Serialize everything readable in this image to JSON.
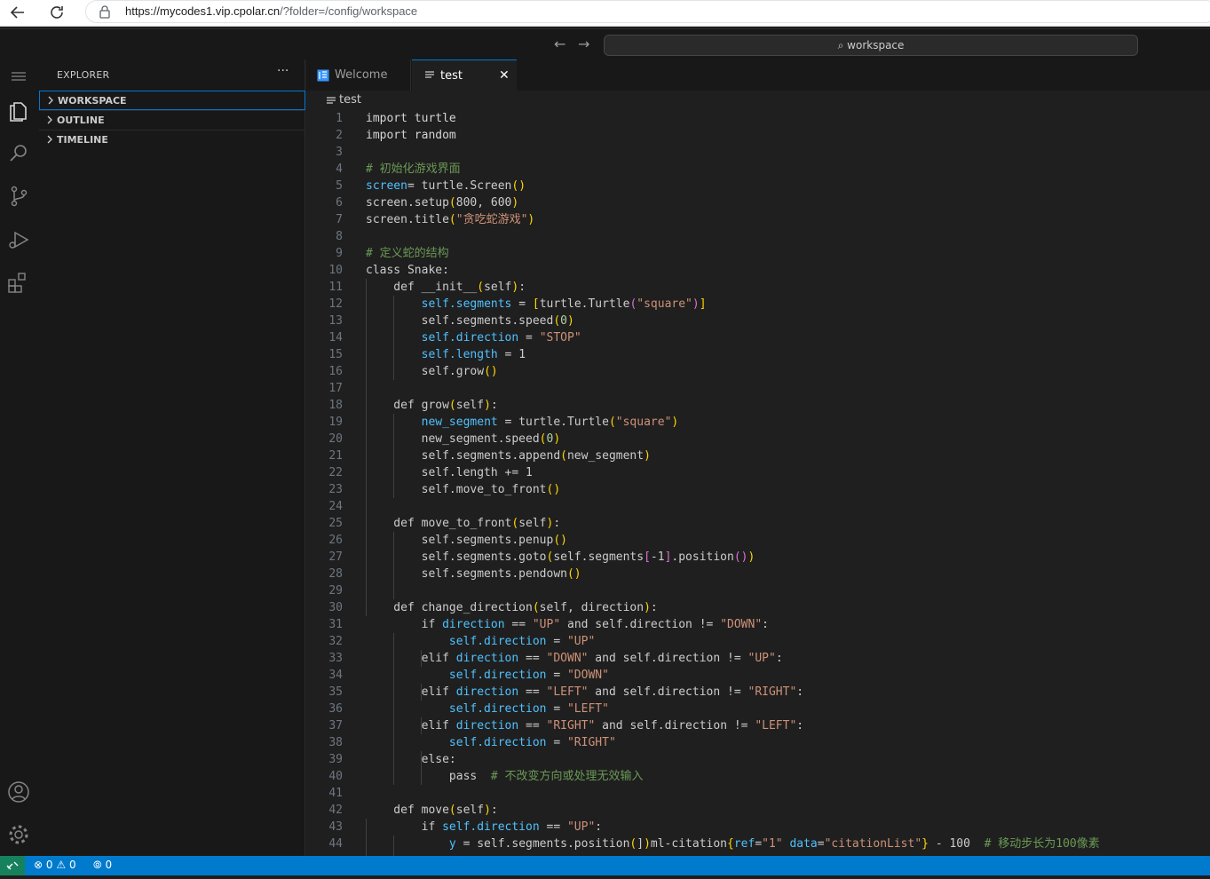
{
  "browser": {
    "url_host": "https://mycodes1.vip.cpolar.cn",
    "url_path": "/?folder=/config/workspace"
  },
  "titlebar": {
    "search_label": "workspace"
  },
  "sidebar": {
    "title": "EXPLORER",
    "more": "···",
    "sections": [
      "WORKSPACE",
      "OUTLINE",
      "TIMELINE"
    ]
  },
  "tabs": {
    "welcome": "Welcome",
    "test": "test",
    "close": "✕"
  },
  "breadcrumb": "test",
  "statusbar": {
    "errors": "0",
    "warnings": "0",
    "ports": "0"
  },
  "editor": {
    "lines": [
      "1",
      "2",
      "3",
      "4",
      "5",
      "6",
      "7",
      "8",
      "9",
      "10",
      "11",
      "12",
      "13",
      "14",
      "15",
      "16",
      "17",
      "18",
      "19",
      "20",
      "21",
      "22",
      "23",
      "24",
      "25",
      "26",
      "27",
      "28",
      "29",
      "30",
      "31",
      "32",
      "33",
      "34",
      "35",
      "36",
      "37",
      "38",
      "39",
      "40",
      "41",
      "42",
      "43",
      "44"
    ],
    "code": [
      [
        [
          "kw",
          "import turtle"
        ]
      ],
      [
        [
          "kw",
          "import random"
        ]
      ],
      [],
      [
        [
          "cmt",
          "# 初始化游戏界面"
        ]
      ],
      [
        [
          "var",
          "screen"
        ],
        [
          "",
          "="
        ],
        [
          "",
          " turtle.Screen"
        ],
        [
          "p1",
          "()"
        ]
      ],
      [
        [
          "",
          "screen.setup"
        ],
        [
          "p1",
          "("
        ],
        [
          "",
          "800, 600"
        ],
        [
          "p1",
          ")"
        ]
      ],
      [
        [
          "",
          "screen.title"
        ],
        [
          "p1",
          "("
        ],
        [
          "str",
          "\"贪吃蛇游戏\""
        ],
        [
          "p1",
          ")"
        ]
      ],
      [],
      [
        [
          "cmt",
          "# 定义蛇的结构"
        ]
      ],
      [
        [
          "",
          "class Snake:"
        ]
      ],
      [
        [
          "",
          "    def __init__"
        ],
        [
          "p1",
          "("
        ],
        [
          "",
          "self"
        ],
        [
          "p1",
          ")"
        ],
        [
          "",
          ":"
        ]
      ],
      [
        [
          "",
          "        "
        ],
        [
          "var",
          "self.segments"
        ],
        [
          "",
          " = "
        ],
        [
          "p1",
          "["
        ],
        [
          "",
          "turtle.Turtle"
        ],
        [
          "p2",
          "("
        ],
        [
          "str",
          "\"square\""
        ],
        [
          "p2",
          ")"
        ],
        [
          "p1",
          "]"
        ]
      ],
      [
        [
          "",
          "        self.segments.speed"
        ],
        [
          "p1",
          "("
        ],
        [
          "num",
          "0"
        ],
        [
          "p1",
          ")"
        ]
      ],
      [
        [
          "",
          "        "
        ],
        [
          "var",
          "self.direction"
        ],
        [
          "",
          " = "
        ],
        [
          "str",
          "\"STOP\""
        ]
      ],
      [
        [
          "",
          "        "
        ],
        [
          "var",
          "self.length"
        ],
        [
          "",
          " = 1"
        ]
      ],
      [
        [
          "",
          "        self.grow"
        ],
        [
          "p1",
          "()"
        ]
      ],
      [],
      [
        [
          "",
          "    def grow"
        ],
        [
          "p1",
          "("
        ],
        [
          "",
          "self"
        ],
        [
          "p1",
          ")"
        ],
        [
          "",
          ":"
        ]
      ],
      [
        [
          "",
          "        "
        ],
        [
          "var",
          "new_segment"
        ],
        [
          "",
          " = turtle.Turtle"
        ],
        [
          "p1",
          "("
        ],
        [
          "str",
          "\"square\""
        ],
        [
          "p1",
          ")"
        ]
      ],
      [
        [
          "",
          "        new_segment.speed"
        ],
        [
          "p1",
          "("
        ],
        [
          "num",
          "0"
        ],
        [
          "p1",
          ")"
        ]
      ],
      [
        [
          "",
          "        self.segments.append"
        ],
        [
          "p1",
          "("
        ],
        [
          "",
          "new_segment"
        ],
        [
          "p1",
          ")"
        ]
      ],
      [
        [
          "",
          "        self.length += 1"
        ]
      ],
      [
        [
          "",
          "        self.move_to_front"
        ],
        [
          "p1",
          "()"
        ]
      ],
      [],
      [
        [
          "",
          "    def move_to_front"
        ],
        [
          "p1",
          "("
        ],
        [
          "",
          "self"
        ],
        [
          "p1",
          ")"
        ],
        [
          "",
          ":"
        ]
      ],
      [
        [
          "",
          "        self.segments.penup"
        ],
        [
          "p1",
          "()"
        ]
      ],
      [
        [
          "",
          "        self.segments.goto"
        ],
        [
          "p1",
          "("
        ],
        [
          "",
          "self.segments"
        ],
        [
          "p2",
          "["
        ],
        [
          "",
          "-1"
        ],
        [
          "p2",
          "]"
        ],
        [
          "",
          ".position"
        ],
        [
          "p2",
          "()"
        ],
        [
          "p1",
          ")"
        ]
      ],
      [
        [
          "",
          "        self.segments.pendown"
        ],
        [
          "p1",
          "()"
        ]
      ],
      [],
      [
        [
          "",
          "    def change_direction"
        ],
        [
          "p1",
          "("
        ],
        [
          "",
          "self, direction"
        ],
        [
          "p1",
          ")"
        ],
        [
          "",
          ":"
        ]
      ],
      [
        [
          "",
          "        if "
        ],
        [
          "var",
          "direction"
        ],
        [
          "",
          " == "
        ],
        [
          "str",
          "\"UP\""
        ],
        [
          "",
          " and self.direction != "
        ],
        [
          "str",
          "\"DOWN\""
        ],
        [
          "",
          ":"
        ]
      ],
      [
        [
          "",
          "            "
        ],
        [
          "var",
          "self.direction"
        ],
        [
          "",
          " = "
        ],
        [
          "str",
          "\"UP\""
        ]
      ],
      [
        [
          "",
          "        elif "
        ],
        [
          "var",
          "direction"
        ],
        [
          "",
          " == "
        ],
        [
          "str",
          "\"DOWN\""
        ],
        [
          "",
          " and self.direction != "
        ],
        [
          "str",
          "\"UP\""
        ],
        [
          "",
          ":"
        ]
      ],
      [
        [
          "",
          "            "
        ],
        [
          "var",
          "self.direction"
        ],
        [
          "",
          " = "
        ],
        [
          "str",
          "\"DOWN\""
        ]
      ],
      [
        [
          "",
          "        elif "
        ],
        [
          "var",
          "direction"
        ],
        [
          "",
          " == "
        ],
        [
          "str",
          "\"LEFT\""
        ],
        [
          "",
          " and self.direction != "
        ],
        [
          "str",
          "\"RIGHT\""
        ],
        [
          "",
          ":"
        ]
      ],
      [
        [
          "",
          "            "
        ],
        [
          "var",
          "self.direction"
        ],
        [
          "",
          " = "
        ],
        [
          "str",
          "\"LEFT\""
        ]
      ],
      [
        [
          "",
          "        elif "
        ],
        [
          "var",
          "direction"
        ],
        [
          "",
          " == "
        ],
        [
          "str",
          "\"RIGHT\""
        ],
        [
          "",
          " and self.direction != "
        ],
        [
          "str",
          "\"LEFT\""
        ],
        [
          "",
          ":"
        ]
      ],
      [
        [
          "",
          "            "
        ],
        [
          "var",
          "self.direction"
        ],
        [
          "",
          " = "
        ],
        [
          "str",
          "\"RIGHT\""
        ]
      ],
      [
        [
          "",
          "        else:"
        ]
      ],
      [
        [
          "",
          "            pass  "
        ],
        [
          "cmt",
          "# 不改变方向或处理无效输入"
        ]
      ],
      [],
      [
        [
          "",
          "    def move"
        ],
        [
          "p1",
          "("
        ],
        [
          "",
          "self"
        ],
        [
          "p1",
          ")"
        ],
        [
          "",
          ":"
        ]
      ],
      [
        [
          "",
          "        if "
        ],
        [
          "var",
          "self.direction"
        ],
        [
          "",
          " == "
        ],
        [
          "str",
          "\"UP\""
        ],
        [
          "",
          ":"
        ]
      ],
      [
        [
          "",
          "            "
        ],
        [
          "var",
          "y"
        ],
        [
          "",
          " = self.segments.position"
        ],
        [
          "p1",
          "("
        ],
        [
          "",
          "]"
        ],
        [
          "p1",
          ")"
        ],
        [
          "",
          "ml-citation"
        ],
        [
          "p1",
          "{"
        ],
        [
          "var",
          "ref"
        ],
        [
          "",
          "="
        ],
        [
          "str",
          "\"1\""
        ],
        [
          "",
          " "
        ],
        [
          "var",
          "data"
        ],
        [
          "",
          "="
        ],
        [
          "str",
          "\"citationList\""
        ],
        [
          "p1",
          "}"
        ],
        [
          "",
          " - 100  "
        ],
        [
          "cmt",
          "# 移动步长为100像素"
        ]
      ]
    ]
  },
  "colors": {
    "accent": "#0078d4",
    "statusbar": "#007acc",
    "remote": "#16825d"
  }
}
